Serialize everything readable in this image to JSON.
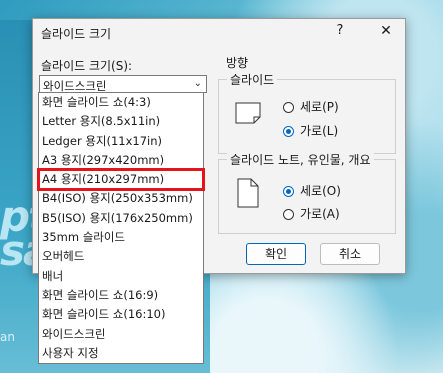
{
  "dialog": {
    "title": "슬라이드 크기",
    "help": "?",
    "close": "✕",
    "size_label": "슬라이드 크기(S):",
    "selected": "와이드스크린",
    "options": [
      "화면 슬라이드 쇼(4:3)",
      "Letter 용지(8.5x11in)",
      "Ledger 용지(11x17in)",
      "A3 용지(297x420mm)",
      "A4 용지(210x297mm)",
      "B4(ISO) 용지(250x353mm)",
      "B5(ISO) 용지(176x250mm)",
      "35mm 슬라이드",
      "오버헤드",
      "배너",
      "화면 슬라이드 쇼(16:9)",
      "화면 슬라이드 쇼(16:10)",
      "와이드스크린",
      "사용자 지정"
    ],
    "highlighted_option": "A4 용지(210x297mm)",
    "orientation_label": "방향",
    "slides": {
      "label": "슬라이드",
      "portrait": "세로(P)",
      "landscape": "가로(L)",
      "selected": "landscape"
    },
    "notes": {
      "label": "슬라이드 노트, 유인물, 개요",
      "portrait": "세로(O)",
      "landscape": "가로(A)",
      "selected": "portrait"
    },
    "ok": "확인",
    "cancel": "취소"
  },
  "background": {
    "big_text": "pt\nsa",
    "small_text": "an"
  },
  "colors": {
    "accent": "#0067c0",
    "highlight": "#e3141a"
  }
}
